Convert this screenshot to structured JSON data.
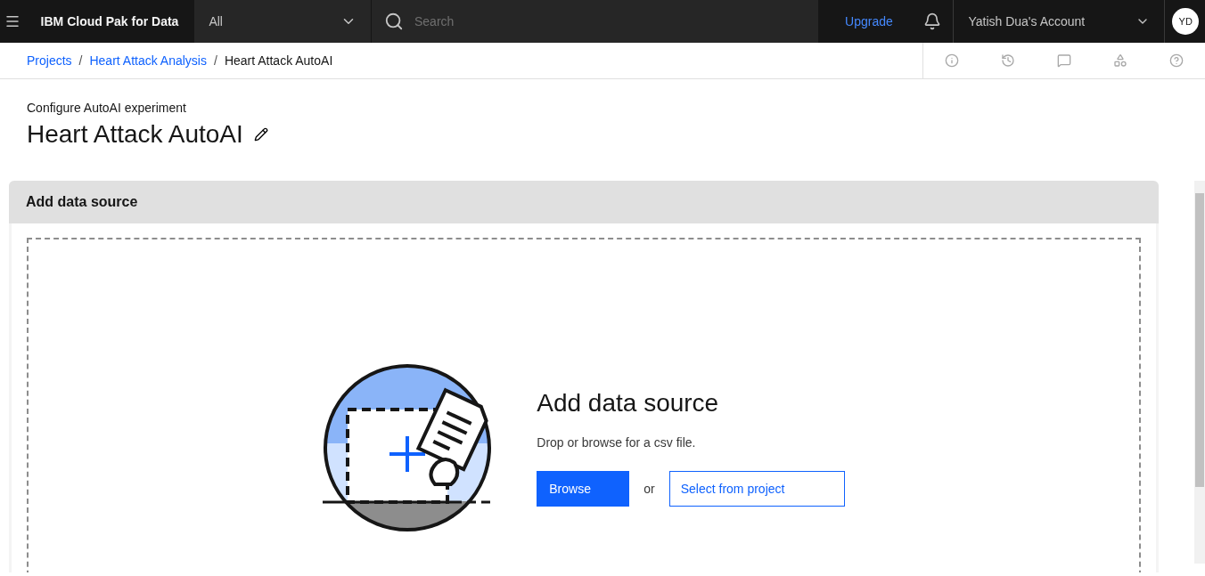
{
  "header": {
    "product": "IBM Cloud Pak for Data",
    "scope": "All",
    "search": {
      "placeholder": "Search"
    },
    "upgrade": "Upgrade",
    "account": "Yatish Dua's Account",
    "avatar": "YD"
  },
  "breadcrumbs": [
    {
      "label": "Projects",
      "current": false
    },
    {
      "label": "Heart Attack Analysis",
      "current": false
    },
    {
      "label": "Heart Attack AutoAI",
      "current": true
    }
  ],
  "breadcrumb_separator": "/",
  "page": {
    "eyebrow": "Configure AutoAI experiment",
    "title": "Heart Attack AutoAI"
  },
  "panel": {
    "title": "Add data source",
    "drop_title": "Add data source",
    "drop_hint": "Drop or browse for a csv file.",
    "browse": "Browse",
    "or": "or",
    "select": "Select from project"
  }
}
